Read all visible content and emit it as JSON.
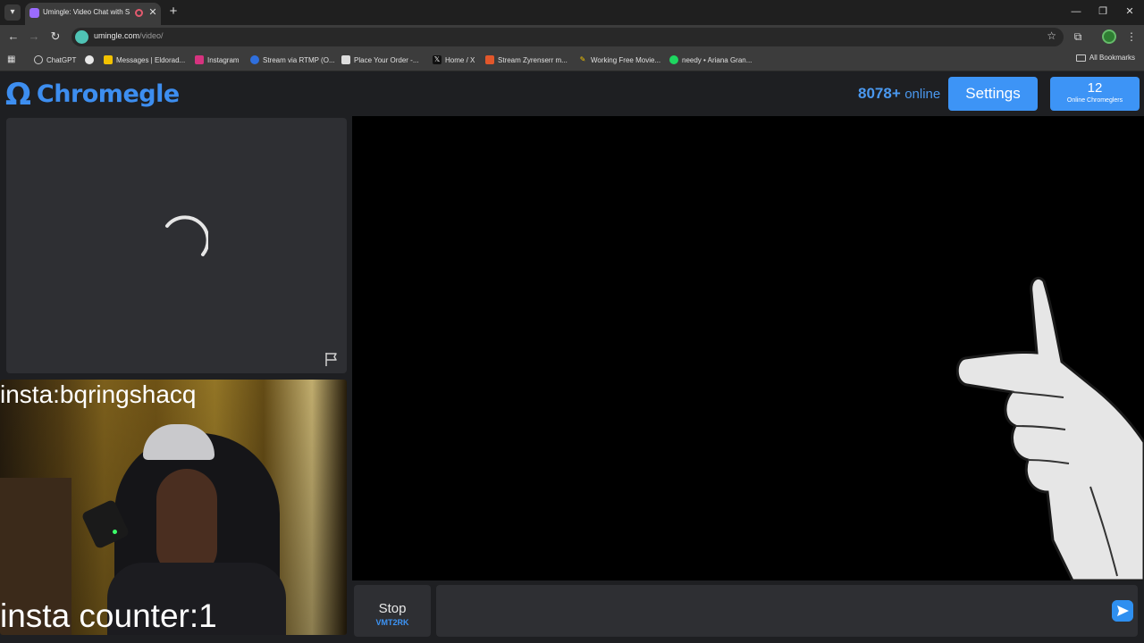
{
  "browser": {
    "tab": {
      "title": "Umingle: Video Chat with S",
      "close_glyph": "✕"
    },
    "new_tab_glyph": "+",
    "window_controls": [
      "—",
      "❐",
      "✕"
    ],
    "nav": {
      "back": "←",
      "forward": "→",
      "reload": "↻"
    },
    "url": {
      "host": "umingle.com",
      "path": "/video/"
    },
    "bookmarks": [
      {
        "label": "ChatGPT",
        "color": "#3a3a3a"
      },
      {
        "label": "",
        "color": "#e8e8e8"
      },
      {
        "label": "Messages | Eldorad...",
        "color": "#f2c200"
      },
      {
        "label": "Instagram",
        "color": "#d6337f"
      },
      {
        "label": "Stream via RTMP (O...",
        "color": "#2f6fdd"
      },
      {
        "label": "Place Your Order -...",
        "color": "#dddddd"
      },
      {
        "label": "Home / X",
        "color": "#111111"
      },
      {
        "label": "Stream Zyrenserr m...",
        "color": "#e2572b"
      },
      {
        "label": "Working Free Movie...",
        "color": "#3c3c3c"
      },
      {
        "label": "needy • Ariana Gran...",
        "color": "#1ed760"
      }
    ],
    "all_bookmarks": "All Bookmarks"
  },
  "header": {
    "logo_symbol": "Ω",
    "logo_text": "Chromegle",
    "online_count": "8078+",
    "online_label": "online",
    "settings_label": "Settings",
    "chromeglers_count": "12",
    "chromeglers_label": "Online Chromeglers"
  },
  "self_video": {
    "overlay_top": "insta:bqringshacq",
    "overlay_bottom": "insta counter:1"
  },
  "controls": {
    "stop_label": "Stop",
    "stop_hint": "VMT2RK",
    "chat_placeholder": ""
  },
  "colors": {
    "accent": "#3d94f6",
    "page_bg": "#1e1f22",
    "panel_bg": "#2e2f33"
  }
}
